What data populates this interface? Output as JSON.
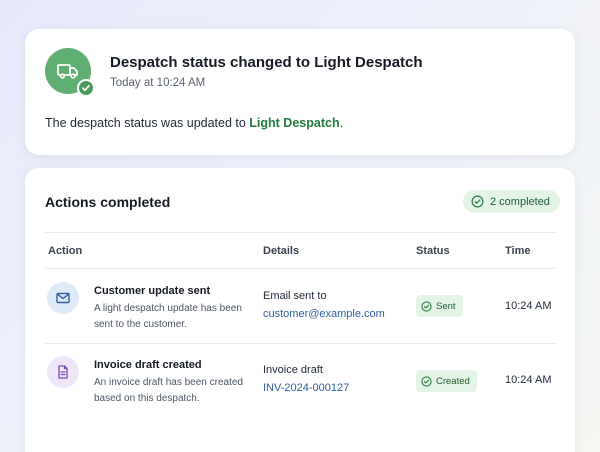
{
  "notification": {
    "title": "Despatch status changed to Light Despatch",
    "time": "Today at 10:24 AM",
    "message_prefix": "The despatch status was updated to ",
    "message_status": "Light Despatch",
    "message_suffix": ".",
    "icon": "truck-icon",
    "badge_icon": "check-icon"
  },
  "actions": {
    "title": "Actions completed",
    "completed_badge": "2 completed",
    "columns": [
      "Action",
      "Details",
      "Status",
      "Time"
    ],
    "rows": [
      {
        "icon": "mail-icon",
        "title": "Customer update sent",
        "description": "A light despatch update has been sent to the customer.",
        "detail_label": "Email sent to",
        "detail_value": "customer@example.com",
        "status": "Sent",
        "time": "10:24 AM"
      },
      {
        "icon": "document-icon",
        "title": "Invoice draft created",
        "description": "An invoice draft has been created based on this despatch.",
        "detail_label": "Invoice draft",
        "detail_value": "INV-2024-000127",
        "status": "Created",
        "time": "10:24 AM"
      }
    ]
  },
  "colors": {
    "accent_green": "#237a3d",
    "avatar_green": "#5fae72",
    "link_blue": "#2d5f9e",
    "pill_green_bg": "#e3f3e6"
  }
}
